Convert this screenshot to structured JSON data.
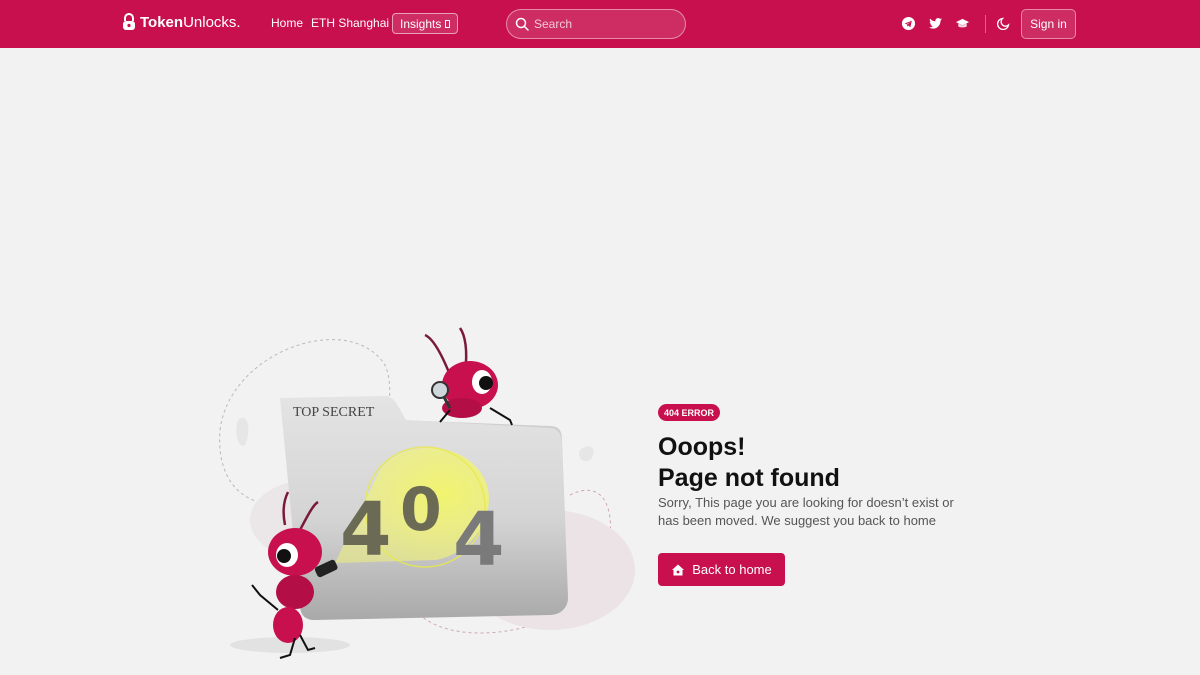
{
  "header": {
    "logo_bold": "Token",
    "logo_light": "Unlocks.",
    "nav": [
      {
        "label": "Home"
      },
      {
        "label": "ETH Shanghai"
      }
    ],
    "insights_label": "Insights",
    "search_placeholder": "Search",
    "social_icons": [
      "telegram-icon",
      "twitter-icon",
      "graduation-cap-icon"
    ],
    "theme_icon": "moon-icon",
    "signin_label": "Sign in"
  },
  "illustration": {
    "folder_label": "TOP SECRET",
    "folder_number": "404"
  },
  "error": {
    "badge": "404 ERROR",
    "title_line1": "Ooops!",
    "title_line2": "Page not found",
    "description": "Sorry, This page you are looking for doesn’t exist or has been moved. We suggest you back to home",
    "button_label": "Back to home"
  },
  "colors": {
    "brand": "#c8104e",
    "background": "#f2f2f2"
  }
}
